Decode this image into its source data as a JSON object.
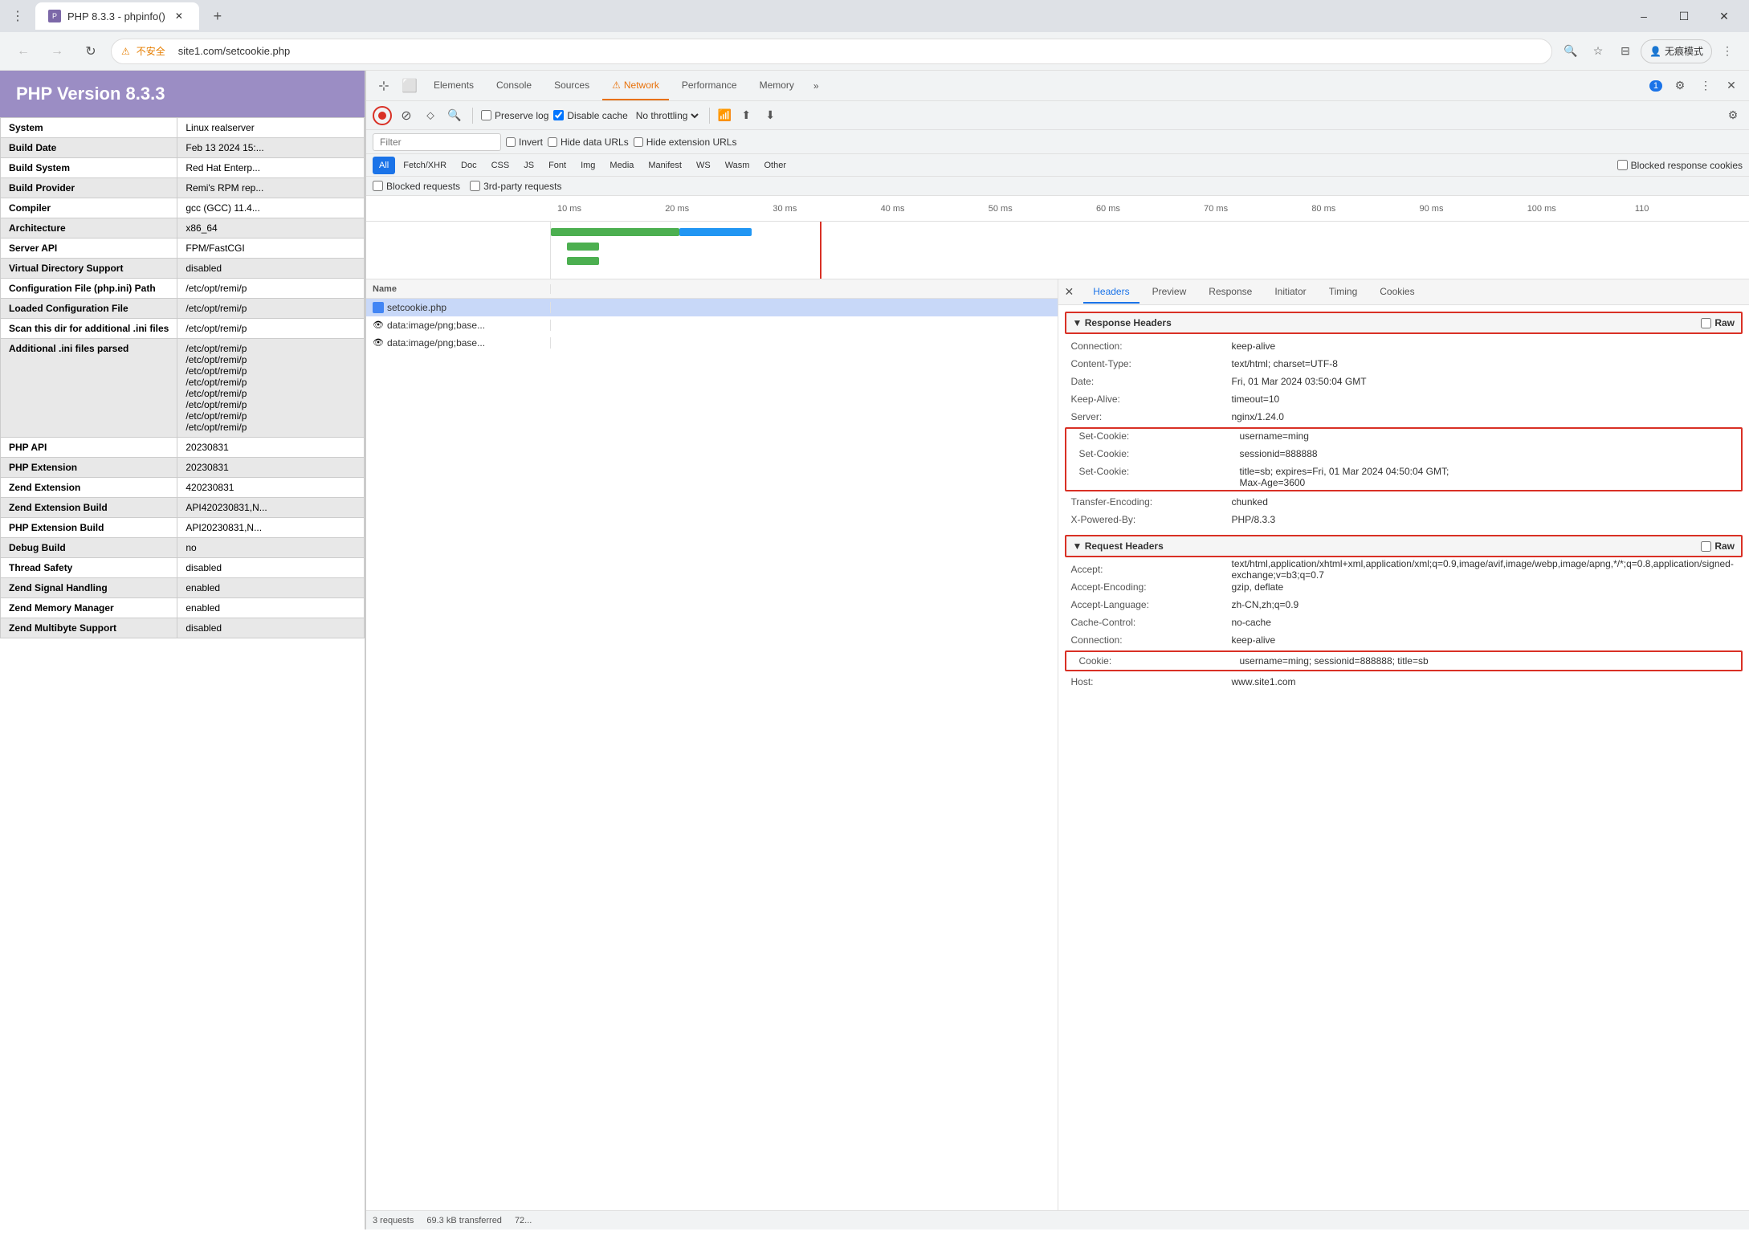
{
  "browser": {
    "tab_title": "PHP 8.3.3 - phpinfo()",
    "tab_favicon": "P",
    "address": "site1.com/setcookie.php",
    "warning_text": "不安全",
    "profile_text": "无痕模式",
    "new_tab": "+",
    "nav": {
      "back": "←",
      "forward": "→",
      "reload": "↻",
      "minimize": "–",
      "maximize": "☐",
      "close": "✕"
    }
  },
  "php_panel": {
    "version": "PHP Version 8.3.3",
    "rows": [
      {
        "key": "System",
        "value": "Linux realserver"
      },
      {
        "key": "Build Date",
        "value": "Feb 13 2024 15:..."
      },
      {
        "key": "Build System",
        "value": "Red Hat Enterp..."
      },
      {
        "key": "Build Provider",
        "value": "Remi's RPM rep..."
      },
      {
        "key": "Compiler",
        "value": "gcc (GCC) 11.4..."
      },
      {
        "key": "Architecture",
        "value": "x86_64"
      },
      {
        "key": "Server API",
        "value": "FPM/FastCGI"
      },
      {
        "key": "Virtual Directory Support",
        "value": "disabled"
      },
      {
        "key": "Configuration File (php.ini) Path",
        "value": "/etc/opt/remi/p"
      },
      {
        "key": "Loaded Configuration File",
        "value": "/etc/opt/remi/p"
      },
      {
        "key": "Scan this dir for additional .ini files",
        "value": "/etc/opt/remi/p"
      },
      {
        "key": "Additional .ini files parsed",
        "value": "/etc/opt/remi/p\n/etc/opt/remi/p\n/etc/opt/remi/p\n/etc/opt/remi/p\n/etc/opt/remi/p\n/etc/opt/remi/p\n/etc/opt/remi/p\n/etc/opt/remi/p"
      },
      {
        "key": "PHP API",
        "value": "20230831"
      },
      {
        "key": "PHP Extension",
        "value": "20230831"
      },
      {
        "key": "Zend Extension",
        "value": "420230831"
      },
      {
        "key": "Zend Extension Build",
        "value": "API420230831,N..."
      },
      {
        "key": "PHP Extension Build",
        "value": "API20230831,N..."
      },
      {
        "key": "Debug Build",
        "value": "no"
      },
      {
        "key": "Thread Safety",
        "value": "disabled"
      },
      {
        "key": "Zend Signal Handling",
        "value": "enabled"
      },
      {
        "key": "Zend Memory Manager",
        "value": "enabled"
      },
      {
        "key": "Zend Multibyte Support",
        "value": "disabled"
      }
    ]
  },
  "devtools": {
    "tabs": [
      "Elements",
      "Console",
      "Sources",
      "Network",
      "Performance",
      "Memory"
    ],
    "active_tab": "Network",
    "badge_count": "1",
    "network": {
      "toolbar": {
        "preserve_log": "Preserve log",
        "disable_cache": "Disable cache",
        "no_throttling": "No throttling"
      },
      "filter": {
        "placeholder": "Filter",
        "invert": "Invert",
        "hide_data_urls": "Hide data URLs",
        "hide_extension_urls": "Hide extension URLs"
      },
      "type_filters": [
        "All",
        "Fetch/XHR",
        "Doc",
        "CSS",
        "JS",
        "Font",
        "Img",
        "Media",
        "Manifest",
        "WS",
        "Wasm",
        "Other"
      ],
      "active_type": "All",
      "blocked_cookies": "Blocked response cookies",
      "blocked_requests": "Blocked requests",
      "third_party": "3rd-party requests",
      "timeline_labels": [
        "10 ms",
        "20 ms",
        "30 ms",
        "40 ms",
        "50 ms",
        "60 ms",
        "70 ms",
        "80 ms",
        "90 ms",
        "100 ms",
        "110"
      ],
      "requests": [
        {
          "name": "setcookie.php",
          "type": "doc",
          "selected": true
        },
        {
          "name": "data:image/png;base...",
          "type": "img",
          "selected": false
        },
        {
          "name": "data:image/png;base...",
          "type": "img",
          "selected": false
        }
      ],
      "status_bar": {
        "requests": "3 requests",
        "transferred": "69.3 kB transferred",
        "extra": "72..."
      },
      "headers_panel": {
        "tabs": [
          "Headers",
          "Preview",
          "Response",
          "Initiator",
          "Timing",
          "Cookies"
        ],
        "active_tab": "Headers",
        "response_headers_label": "▼ Response Headers",
        "raw_label": "Raw",
        "response_headers": [
          {
            "name": "Connection:",
            "value": "keep-alive"
          },
          {
            "name": "Content-Type:",
            "value": "text/html; charset=UTF-8"
          },
          {
            "name": "Date:",
            "value": "Fri, 01 Mar 2024 03:50:04 GMT"
          },
          {
            "name": "Keep-Alive:",
            "value": "timeout=10"
          },
          {
            "name": "Server:",
            "value": "nginx/1.24.0"
          }
        ],
        "set_cookies": [
          {
            "name": "Set-Cookie:",
            "value": "username=ming"
          },
          {
            "name": "Set-Cookie:",
            "value": "sessionid=888888"
          },
          {
            "name": "Set-Cookie:",
            "value": "title=sb; expires=Fri, 01 Mar 2024 04:50:04 GMT;\nMax-Age=3600"
          }
        ],
        "response_headers_2": [
          {
            "name": "Transfer-Encoding:",
            "value": "chunked"
          },
          {
            "name": "X-Powered-By:",
            "value": "PHP/8.3.3"
          }
        ],
        "request_headers_label": "▼ Request Headers",
        "request_headers": [
          {
            "name": "Accept:",
            "value": "text/html,application/xhtml+xml,application/xml;q=0.9,image/avif,image/webp,image/apng,*/*;q=0.8,application/signed-exchange;v=b3;q=0.7"
          },
          {
            "name": "Accept-Encoding:",
            "value": "gzip, deflate"
          },
          {
            "name": "Accept-Language:",
            "value": "zh-CN,zh;q=0.9"
          },
          {
            "name": "Cache-Control:",
            "value": "no-cache"
          },
          {
            "name": "Connection:",
            "value": "keep-alive"
          }
        ],
        "cookie_row": {
          "name": "Cookie:",
          "value": "username=ming; sessionid=888888; title=sb"
        },
        "host_row": {
          "name": "Host:",
          "value": "www.site1.com"
        }
      }
    }
  }
}
